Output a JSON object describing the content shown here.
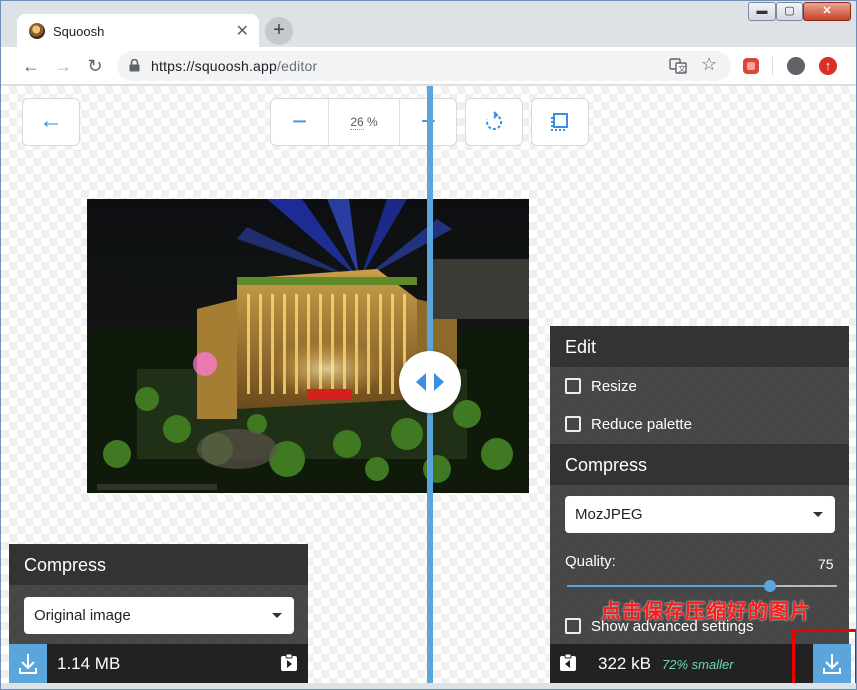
{
  "browser": {
    "tab_title": "Squoosh",
    "tab_close": "✕",
    "new_tab": "+",
    "url_host": "https://squoosh.app",
    "url_path": "/editor",
    "window_min": "▬",
    "window_max": "▢",
    "window_close": "✕"
  },
  "toolbar": {
    "zoom_minus": "−",
    "zoom_value": "26",
    "zoom_unit": " %",
    "zoom_plus": "+"
  },
  "right_panel": {
    "edit_header": "Edit",
    "resize_label": "Resize",
    "reduce_palette_label": "Reduce palette",
    "compress_header": "Compress",
    "codec_selected": "MozJPEG",
    "quality_label": "Quality:",
    "quality_value": "75",
    "quality_fraction": 0.75,
    "advanced_label": "Show advanced settings",
    "result_size": "322 kB",
    "result_delta": "72% smaller"
  },
  "left_panel": {
    "compress_header": "Compress",
    "codec_selected": "Original image",
    "original_size": "1.14 MB"
  },
  "annotation_text": "点击保存压缩好的图片",
  "colors": {
    "accent": "#5aa6dc",
    "annotation": "#ff1a1a",
    "smaller_text": "#6dd7b4"
  }
}
